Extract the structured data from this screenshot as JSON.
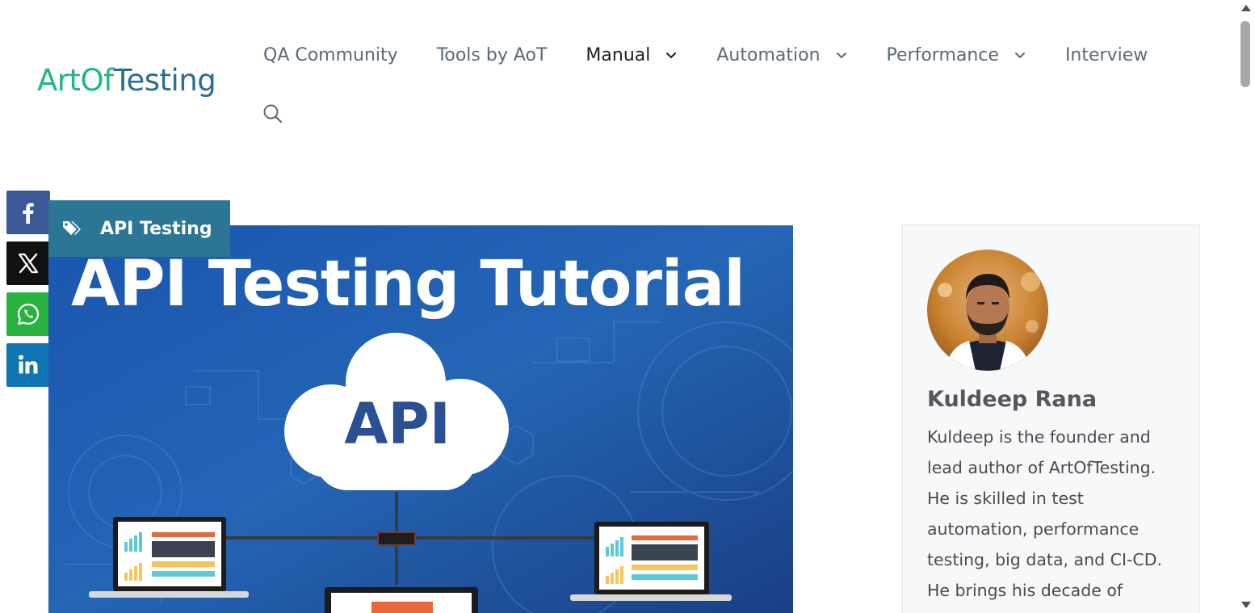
{
  "logo": {
    "part1": "ArtOf",
    "part2": "Testing"
  },
  "nav": {
    "items": [
      {
        "label": "QA Community",
        "has_dropdown": false,
        "active": false
      },
      {
        "label": "Tools by AoT",
        "has_dropdown": false,
        "active": false
      },
      {
        "label": "Manual",
        "has_dropdown": true,
        "active": true
      },
      {
        "label": "Automation",
        "has_dropdown": true,
        "active": false
      },
      {
        "label": "Performance",
        "has_dropdown": true,
        "active": false
      },
      {
        "label": "Interview",
        "has_dropdown": false,
        "active": false
      }
    ],
    "search_icon": "search-icon"
  },
  "share": {
    "items": [
      {
        "network": "facebook",
        "icon": "facebook-icon",
        "color": "#3b5998"
      },
      {
        "network": "x",
        "icon": "x-icon",
        "color": "#111111"
      },
      {
        "network": "whatsapp",
        "icon": "whatsapp-icon",
        "color": "#2ab240"
      },
      {
        "network": "linkedin",
        "icon": "linkedin-icon",
        "color": "#0e74b3"
      }
    ]
  },
  "post": {
    "category": "API Testing",
    "category_icon": "tags-icon",
    "hero": {
      "title": "API Testing Tutorial",
      "cloud_label": "API"
    }
  },
  "author": {
    "name": "Kuldeep Rana",
    "bio": "Kuldeep is the founder and lead author of ArtOfTesting. He is skilled in test automation, performance testing, big data, and CI-CD. He brings his decade of"
  },
  "colors": {
    "brand_green": "#1fb58a",
    "brand_blue": "#2a6e91",
    "tag_bg": "#2b7595",
    "nav_text": "#5b6a78",
    "nav_active": "#1b1f24"
  }
}
